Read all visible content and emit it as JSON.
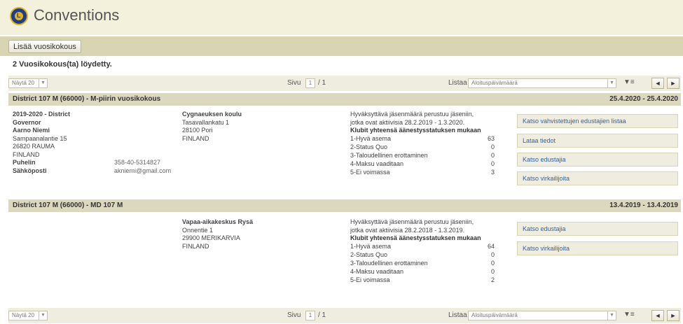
{
  "app": {
    "title": "Conventions"
  },
  "toolbar": {
    "add_label": "Lisää vuosikokous"
  },
  "results_text": "2 Vuosikokous(ta) löydetty.",
  "pager": {
    "page_size": "Näytä 20",
    "page_label": "Sivu",
    "page_value": "1",
    "page_total": "/ 1",
    "sort_label": "Listaa",
    "sort_value": "Aloituspäivämäärä",
    "sort_icon": "sort-icon",
    "prev_icon": "◄",
    "next_icon": "►"
  },
  "conventions": [
    {
      "title": "District 107 M (66000) - M-piirin vuosikokous",
      "dates": "25.4.2020 - 25.4.2020",
      "contact": {
        "role_line1": "2019-2020 - District",
        "role_line2": "Governor",
        "name": "Aarno Niemi",
        "addr1": "Sampaanalantie 15",
        "addr2": "26820 RAUMA",
        "country": "FINLAND",
        "phone_label": "Puhelin",
        "phone": "358-40-5314827",
        "email_label": "Sähköposti",
        "email": "akniemi@gmail.com"
      },
      "venue": {
        "name": "Cygnaeuksen koulu",
        "addr1": "Tasavallankatu 1",
        "addr2": "28100 Pori",
        "country": "FINLAND"
      },
      "stats": {
        "intro1": "Hyväksyttävä jäsenmäärä perustuu jäseniin,",
        "intro2": "jotka ovat aktiivisia 28.2.2019 - 1.3.2020.",
        "heading": "Klubit yhteensä äänestysstatuksen mukaan",
        "rows": [
          {
            "label": "1-Hyvä asema",
            "value": "63"
          },
          {
            "label": "2-Status Quo",
            "value": "0"
          },
          {
            "label": "3-Taloudellinen erottaminen",
            "value": "0"
          },
          {
            "label": "4-Maksu vaaditaan",
            "value": "0"
          },
          {
            "label": "5-Ei voimassa",
            "value": "3"
          }
        ]
      },
      "actions": [
        "Katso vahvistettujen edustajien listaa",
        "Lataa tiedot",
        "Katso edustajia",
        "Katso virkailijoita"
      ]
    },
    {
      "title": "District 107 M (66000) - MD 107 M",
      "dates": "13.4.2019 - 13.4.2019",
      "venue": {
        "name": "Vapaa-aikakeskus Rysä",
        "addr1": "Onnentie 1",
        "addr2": "29900 MERIKARVIA",
        "country": "FINLAND"
      },
      "stats": {
        "intro1": "Hyväksyttävä jäsenmäärä perustuu jäseniin,",
        "intro2": "jotka ovat aktiivisia 28.2.2018 - 1.3.2019.",
        "heading": "Klubit yhteensä äänestysstatuksen mukaan",
        "rows": [
          {
            "label": "1-Hyvä asema",
            "value": "64"
          },
          {
            "label": "2-Status Quo",
            "value": "0"
          },
          {
            "label": "3-Taloudellinen erottaminen",
            "value": "0"
          },
          {
            "label": "4-Maksu vaaditaan",
            "value": "0"
          },
          {
            "label": "5-Ei voimassa",
            "value": "2"
          }
        ]
      },
      "actions": [
        "Katso edustajia",
        "Katso virkailijoita"
      ]
    }
  ]
}
